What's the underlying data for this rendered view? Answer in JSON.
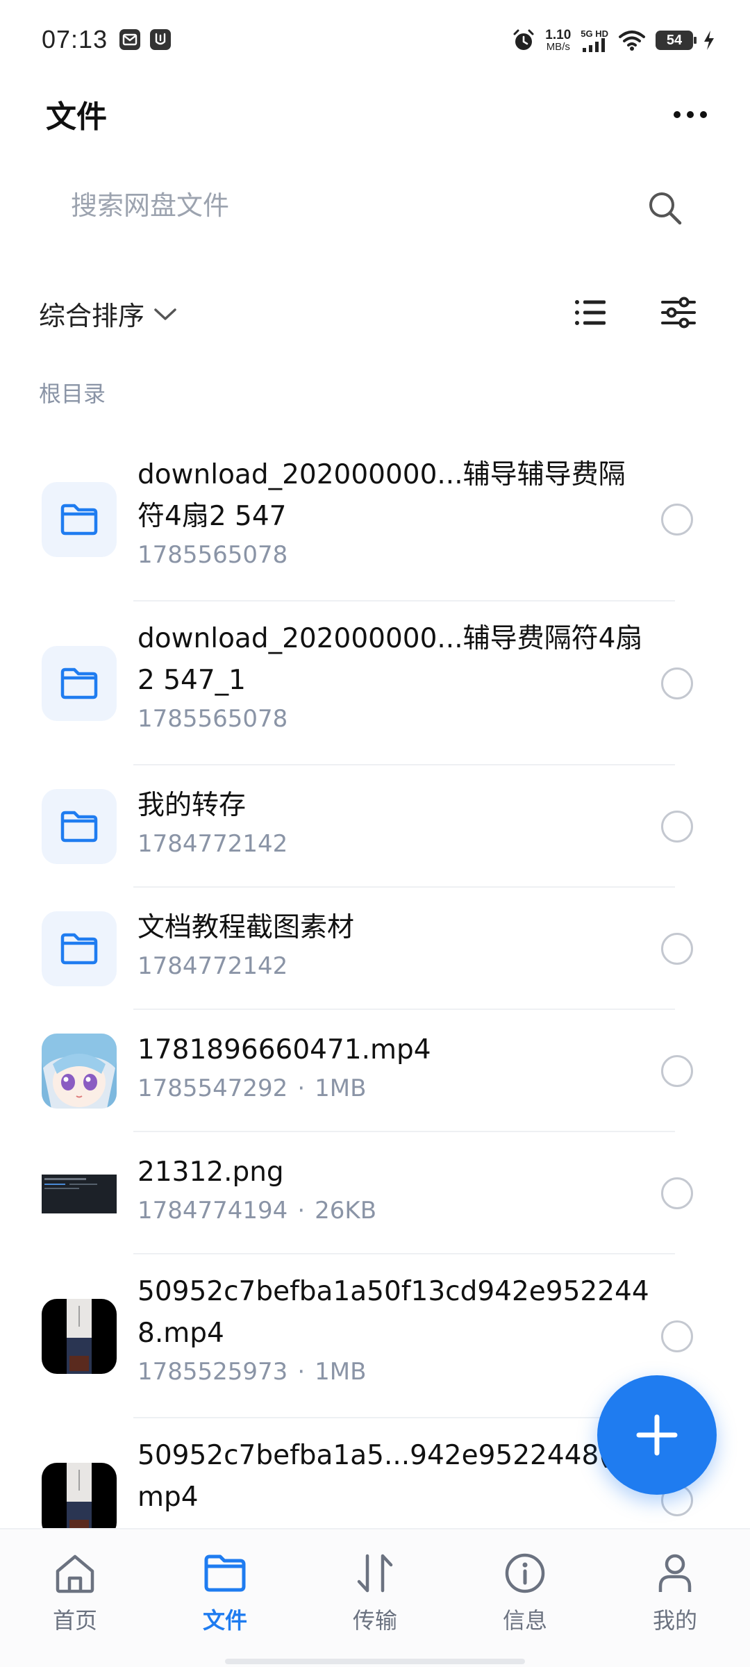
{
  "status_bar": {
    "time": "07:13",
    "speed_value": "1.10",
    "speed_unit": "MB/s",
    "network_top": "5G HD",
    "network_bottom": "5G",
    "battery": "54"
  },
  "header": {
    "title": "文件"
  },
  "search": {
    "placeholder": "搜索网盘文件"
  },
  "sort": {
    "label": "综合排序"
  },
  "breadcrumb": "根目录",
  "files": [
    {
      "name": "download_202000000...辅导辅导费隔符4扇2 547",
      "meta": "1785565078",
      "size": "",
      "kind": "folder"
    },
    {
      "name": "download_202000000...辅导费隔符4扇2 547_1",
      "meta": "1785565078",
      "size": "",
      "kind": "folder"
    },
    {
      "name": "我的转存",
      "meta": "1784772142",
      "size": "",
      "kind": "folder"
    },
    {
      "name": "文档教程截图素材",
      "meta": "1784772142",
      "size": "",
      "kind": "folder"
    },
    {
      "name": "1781896660471.mp4",
      "meta": "1785547292",
      "size": "1MB",
      "kind": "anime"
    },
    {
      "name": "21312.png",
      "meta": "1784774194",
      "size": "26KB",
      "kind": "screenshot"
    },
    {
      "name": "50952c7befba1a50f13cd942e9522448.mp4",
      "meta": "1785525973",
      "size": "1MB",
      "kind": "video"
    },
    {
      "name": "50952c7befba1a5...942e9522448(1).mp4",
      "meta": "",
      "size": "",
      "kind": "video"
    }
  ],
  "bottom_nav": [
    {
      "label": "首页",
      "icon": "home-icon",
      "active": false
    },
    {
      "label": "文件",
      "icon": "folder-icon",
      "active": true
    },
    {
      "label": "传输",
      "icon": "transfer-icon",
      "active": false
    },
    {
      "label": "信息",
      "icon": "info-icon",
      "active": false
    },
    {
      "label": "我的",
      "icon": "profile-icon",
      "active": false
    }
  ],
  "colors": {
    "accent": "#1f7cf0",
    "muted_text": "#8a94a6",
    "folder_bg": "#eef4fd"
  }
}
